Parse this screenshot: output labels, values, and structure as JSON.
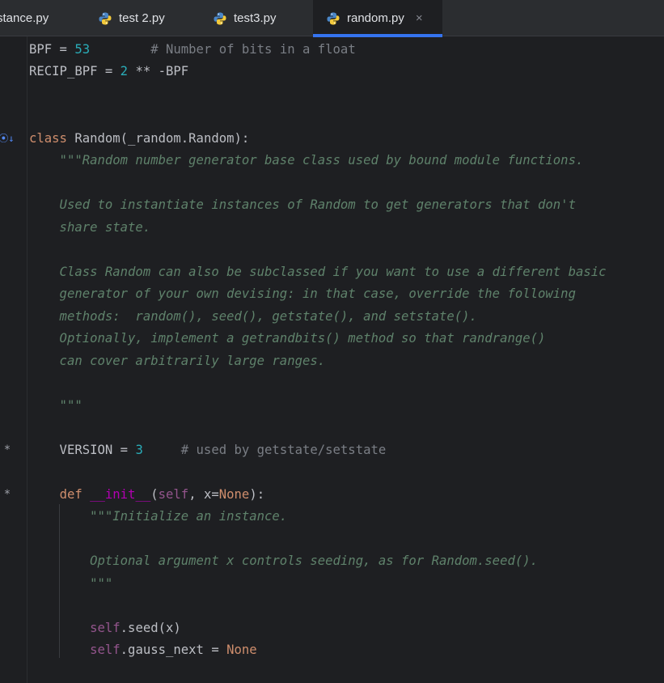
{
  "tabs": [
    {
      "label": "stance.py",
      "has_icon": false
    },
    {
      "label": "test 2.py",
      "has_icon": true
    },
    {
      "label": "test3.py",
      "has_icon": true
    },
    {
      "label": "random.py",
      "has_icon": true,
      "active": true
    }
  ],
  "close_glyph": "×",
  "gutter_marks": {
    "override": "⦿↓",
    "star1": "*",
    "star2": "*"
  },
  "code": {
    "l1": {
      "a": "BPF = ",
      "b": "53",
      "c": "        # Number of bits in a float"
    },
    "l2": {
      "a": "RECIP_BPF = ",
      "b": "2",
      "c": " ** -BPF"
    },
    "l3": {
      "a": "class",
      "b": " Random(_random.Random):"
    },
    "l4": "    \"\"\"Random number generator base class used by bound module functions.",
    "l5": "    Used to instantiate instances of Random to get generators that don't",
    "l6": "    share state.",
    "l7": "    Class Random can also be subclassed if you want to use a different basic",
    "l8": "    generator of your own devising: in that case, override the following",
    "l9": "    methods:  random(), seed(), getstate(), and setstate().",
    "l10": "    Optionally, implement a getrandbits() method so that randrange()",
    "l11": "    can cover arbitrarily large ranges.",
    "l12": "    \"\"\"",
    "l13": {
      "a": "    VERSION = ",
      "b": "3",
      "c": "     # used by getstate/setstate"
    },
    "l14": {
      "a": "    ",
      "b": "def",
      "c": " ",
      "d": "__init__",
      "e": "(",
      "f": "self",
      "g": ", x=",
      "h": "None",
      "i": "):"
    },
    "l15": "        \"\"\"Initialize an instance.",
    "l16": "        Optional argument x controls seeding, as for Random.seed().",
    "l17": "        \"\"\"",
    "l18": {
      "a": "        ",
      "b": "self",
      "c": ".seed(x)"
    },
    "l19": {
      "a": "        ",
      "b": "self",
      "c": ".gauss_next = ",
      "d": "None"
    }
  }
}
